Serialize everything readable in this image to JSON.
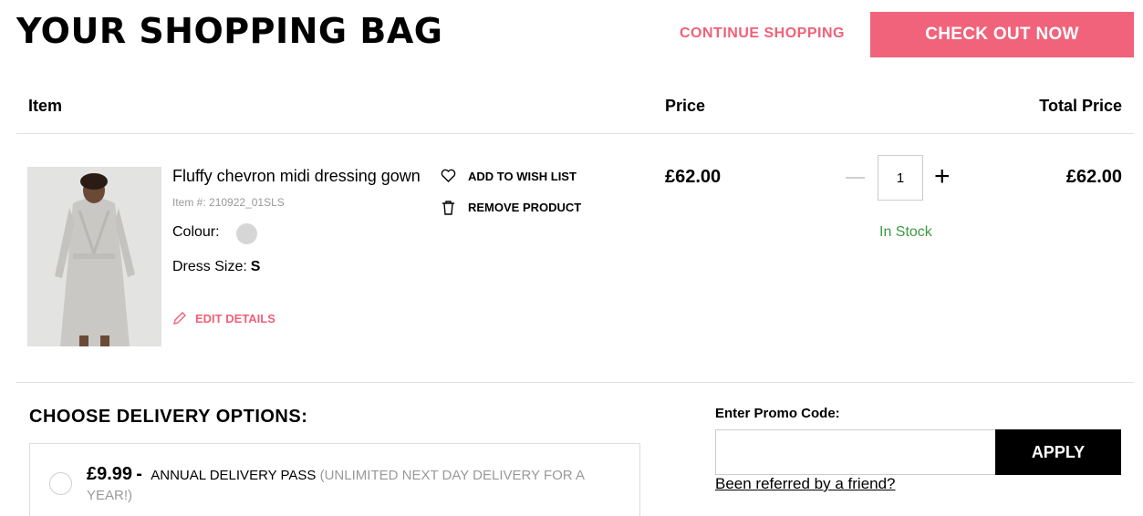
{
  "header": {
    "title": "YOUR SHOPPING BAG",
    "continue_label": "CONTINUE SHOPPING",
    "checkout_label": "CHECK OUT NOW"
  },
  "columns": {
    "item": "Item",
    "price": "Price",
    "total": "Total Price"
  },
  "product": {
    "name": "Fluffy chevron midi dressing gown",
    "sku": "Item #: 210922_01SLS",
    "colour_label": "Colour:",
    "colour_swatch": "#d6d6d6",
    "size_label": "Dress Size:",
    "size_value": "S",
    "edit_label": "EDIT DETAILS",
    "wish_label": "ADD TO WISH LIST",
    "remove_label": "REMOVE PRODUCT",
    "price": "£62.00",
    "quantity": "1",
    "stock": "In Stock",
    "total": "£62.00"
  },
  "delivery": {
    "title": "CHOOSE DELIVERY OPTIONS:",
    "options": [
      {
        "price": "£9.99",
        "dash": "-",
        "name": "ANNUAL DELIVERY PASS",
        "desc": "(UNLIMITED NEXT DAY DELIVERY FOR A YEAR!)"
      }
    ]
  },
  "promo": {
    "label": "Enter Promo Code:",
    "value": "",
    "apply_label": "APPLY",
    "referred_label": "Been referred by a friend?"
  },
  "colors": {
    "accent": "#f0637a",
    "stock": "#3c9a40"
  },
  "icons": {
    "wish": "heart-icon",
    "remove": "trash-icon",
    "edit": "pencil-icon"
  }
}
